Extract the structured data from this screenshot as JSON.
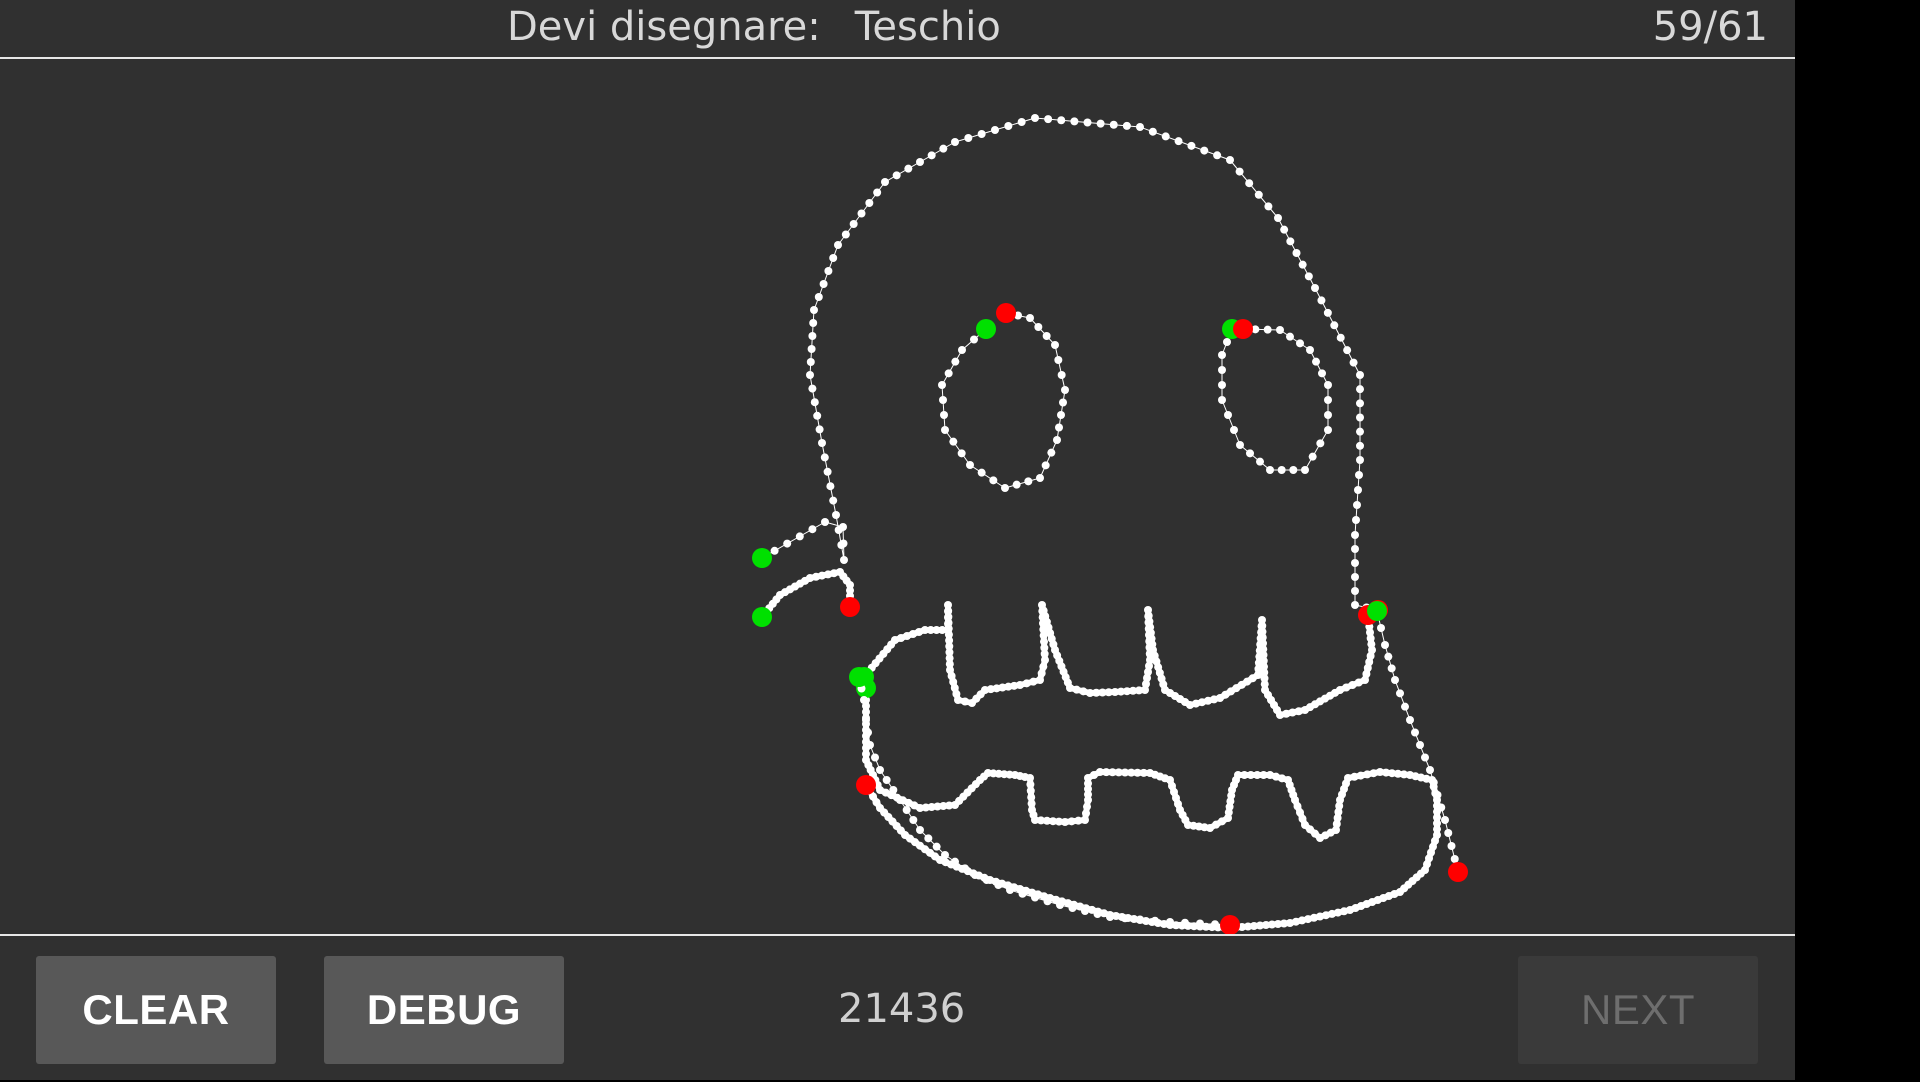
{
  "header": {
    "prompt_label": "Devi disegnare:",
    "target_word": "Teschio",
    "progress": "59/61"
  },
  "footer": {
    "clear_label": "CLEAR",
    "debug_label": "DEBUG",
    "score": "21436",
    "next_label": "NEXT",
    "next_enabled": false
  },
  "colors": {
    "background": "#303030",
    "stroke": "#ffffff",
    "stroke_start": "#00e000",
    "stroke_end": "#ff0000",
    "button_bg": "#585858"
  },
  "drawing": {
    "subject": "skull",
    "stroke_count": 8
  }
}
